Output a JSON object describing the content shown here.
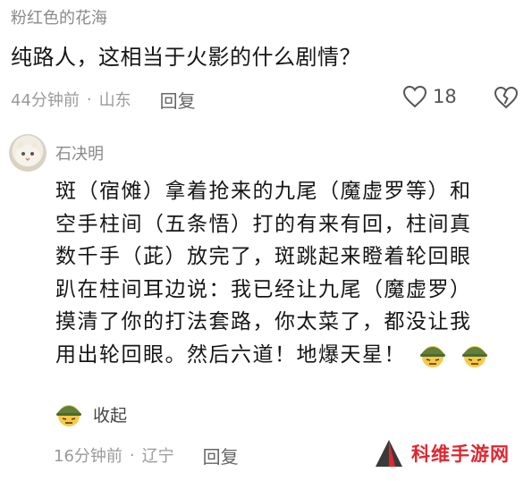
{
  "top_comment": {
    "author": "粉红色的花海",
    "text": "纯路人，这相当于火影的什么剧情？",
    "time": "44分钟前",
    "location": "山东",
    "reply_label": "回复",
    "likes": "18"
  },
  "reply": {
    "author": "石决明",
    "lines": [
      "斑（宿傩）拿着抢来的九尾（魔虚罗等）和",
      "空手柱间（五条悟）打的有来有回，柱间真",
      "数千手（茈）放完了，斑跳起来瞪着轮回眼",
      "趴在柱间耳边说：我已经让九尾（魔虚罗）",
      "摸清了你的打法套路，你太菜了，都没让我",
      "用出轮回眼。然后六道！地爆天星！"
    ],
    "collapse_label": "收起",
    "time": "16分钟前",
    "location": "辽宁",
    "reply_label": "回复"
  },
  "separator": "·",
  "icons": {
    "like": "heart-outline-icon",
    "dislike": "broken-heart-icon",
    "emoji": "soldier-helmet-emoji-icon"
  },
  "watermark": {
    "text": "科维手游网",
    "color": "#e0262f"
  }
}
